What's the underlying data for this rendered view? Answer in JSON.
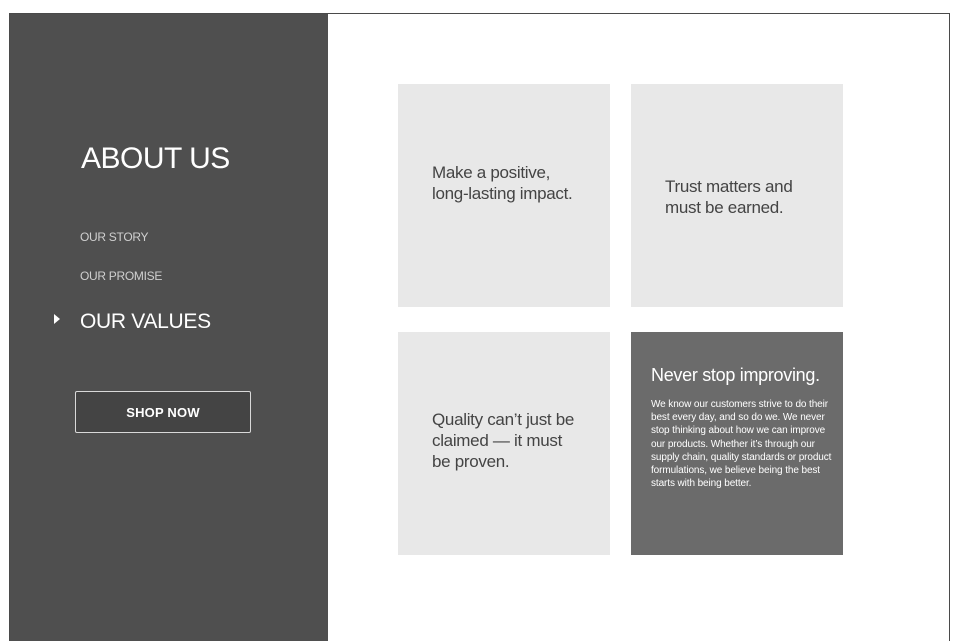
{
  "sidebar": {
    "title": "ABOUT US",
    "nav": {
      "story": "OUR STORY",
      "promise": "OUR PROMISE",
      "values": "OUR VALUES"
    },
    "button_label": "SHOP NOW"
  },
  "tiles": [
    {
      "text": "Make a positive, long-lasting impact."
    },
    {
      "text": "Trust matters and must be earned."
    },
    {
      "text": "Quality can’t just be claimed — it must be proven."
    },
    {
      "heading": "Never stop improving.",
      "body": "We know our customers strive to do their best every day, and so do we. We never stop thinking about how we can improve our products. Whether it’s through our supply chain, quality standards or product formulations, we believe being the best starts with being better."
    }
  ],
  "colors": {
    "sidebar_bg": "#4f4f4f",
    "tile_bg": "#e8e8e8",
    "featured_tile_bg": "#6b6b6b"
  },
  "icons": {
    "active_indicator": "caret-right-icon"
  }
}
